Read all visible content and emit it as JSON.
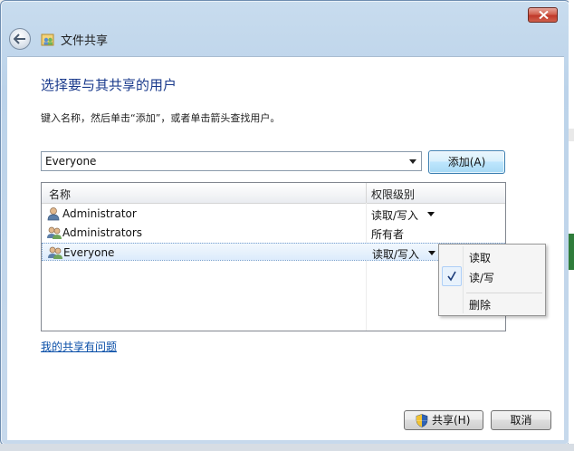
{
  "window": {
    "title": "文件共享"
  },
  "main": {
    "heading": "选择要与其共享的用户",
    "instructions": "键入名称，然后单击“添加”，或者单击箭头查找用户。",
    "user_input_value": "Everyone",
    "add_button_label": "添加(A)",
    "help_link": "我的共享有问题"
  },
  "table": {
    "columns": [
      "名称",
      "权限级别"
    ],
    "rows": [
      {
        "name": "Administrator",
        "permission": "读取/写入",
        "icon": "user-icon",
        "has_dropdown": true
      },
      {
        "name": "Administrators",
        "permission": "所有者",
        "icon": "group-icon",
        "has_dropdown": false
      },
      {
        "name": "Everyone",
        "permission": "读取/写入",
        "icon": "group-icon",
        "has_dropdown": true,
        "selected": true
      }
    ]
  },
  "permission_menu": {
    "items": [
      {
        "label": "读取",
        "checked": false
      },
      {
        "label": "读/写",
        "checked": true
      },
      {
        "label": "删除",
        "checked": false
      }
    ]
  },
  "footer": {
    "share_button_label": "共享(H)",
    "cancel_button_label": "取消"
  },
  "icons": {
    "close": "close-icon",
    "back": "back-arrow-icon",
    "title": "file-share-icon",
    "shield": "uac-shield-icon"
  },
  "colors": {
    "heading": "#1a3a8c",
    "link": "#0a4fa8",
    "close_button": "#c0392b"
  }
}
